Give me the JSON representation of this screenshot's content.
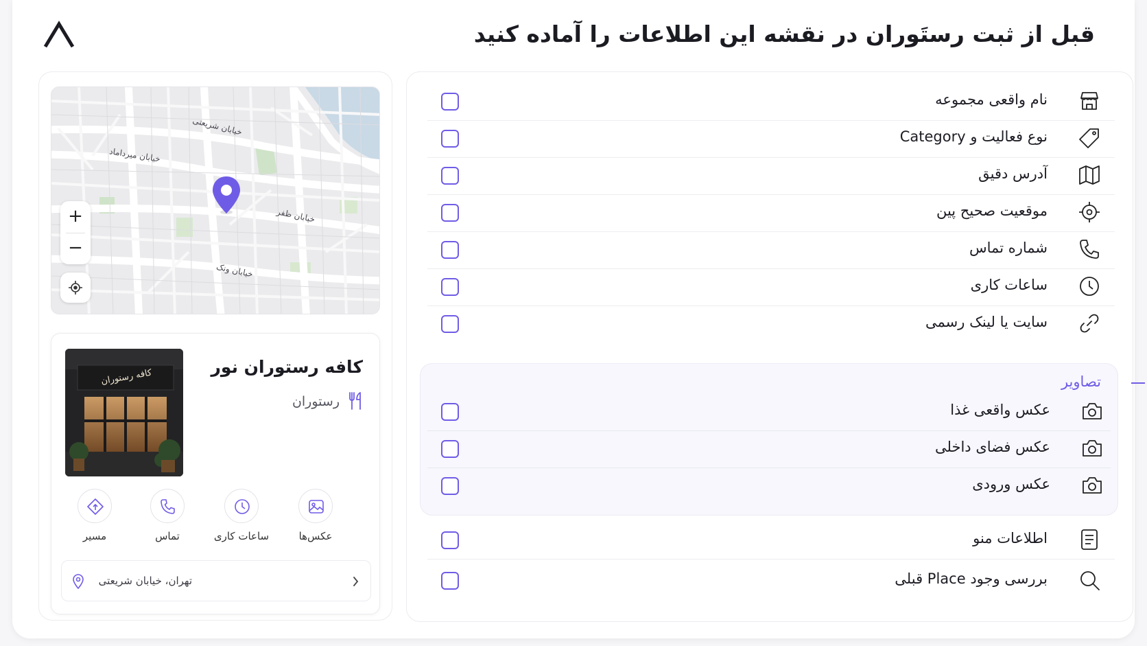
{
  "page": {
    "title": "قبل از ثبت رستَوران در نقشه این اطلاعات را آماده کنید",
    "accent_color": "#6f5ce6",
    "logo_icon": "chevron-up-logo"
  },
  "checklist": {
    "items": [
      {
        "label": "نام واقعی مجموعه",
        "icon": "storefront-icon",
        "checked": false
      },
      {
        "label": "نوع فعالیت و Category",
        "icon": "tag-icon",
        "checked": false
      },
      {
        "label": "آدرس دقیق",
        "icon": "map-icon",
        "checked": false
      },
      {
        "label": "موقعیت صحیح پین",
        "icon": "crosshair-icon",
        "checked": false
      },
      {
        "label": "شماره تماس",
        "icon": "phone-icon",
        "checked": false
      },
      {
        "label": "ساعات کاری",
        "icon": "clock-icon",
        "checked": false
      },
      {
        "label": "سایت یا لینک رسمی",
        "icon": "link-icon",
        "checked": false
      }
    ],
    "images_section": {
      "title": "تصاویر",
      "items": [
        {
          "label": "عکس واقعی غذا",
          "icon": "camera-icon",
          "checked": false
        },
        {
          "label": "عکس فضای داخلی",
          "icon": "camera-icon",
          "checked": false
        },
        {
          "label": "عکس ورودی",
          "icon": "camera-icon",
          "checked": false
        }
      ]
    },
    "after_items": [
      {
        "label": "اطلاعات منو",
        "icon": "document-icon",
        "checked": false
      },
      {
        "label": "بررسی وجود Place قبلی",
        "icon": "search-icon",
        "checked": false
      }
    ]
  },
  "preview": {
    "map": {
      "streets": [
        "خیابان شریعتی",
        "خیابان میرداماد",
        "خیابان ظفر",
        "خیابان ونک"
      ],
      "zoom_in": "+",
      "zoom_out": "−"
    },
    "card": {
      "name": "کافه رستوران نور",
      "category": "رستوران",
      "photo_sign": "کافه رستوران",
      "actions": [
        {
          "label": "عکس‌ها",
          "icon": "image-icon"
        },
        {
          "label": "ساعات کاری",
          "icon": "clock-icon"
        },
        {
          "label": "تماس",
          "icon": "phone-icon"
        },
        {
          "label": "مسیر",
          "icon": "directions-icon"
        }
      ],
      "address": "تهران، خیابان شریعتی"
    }
  }
}
